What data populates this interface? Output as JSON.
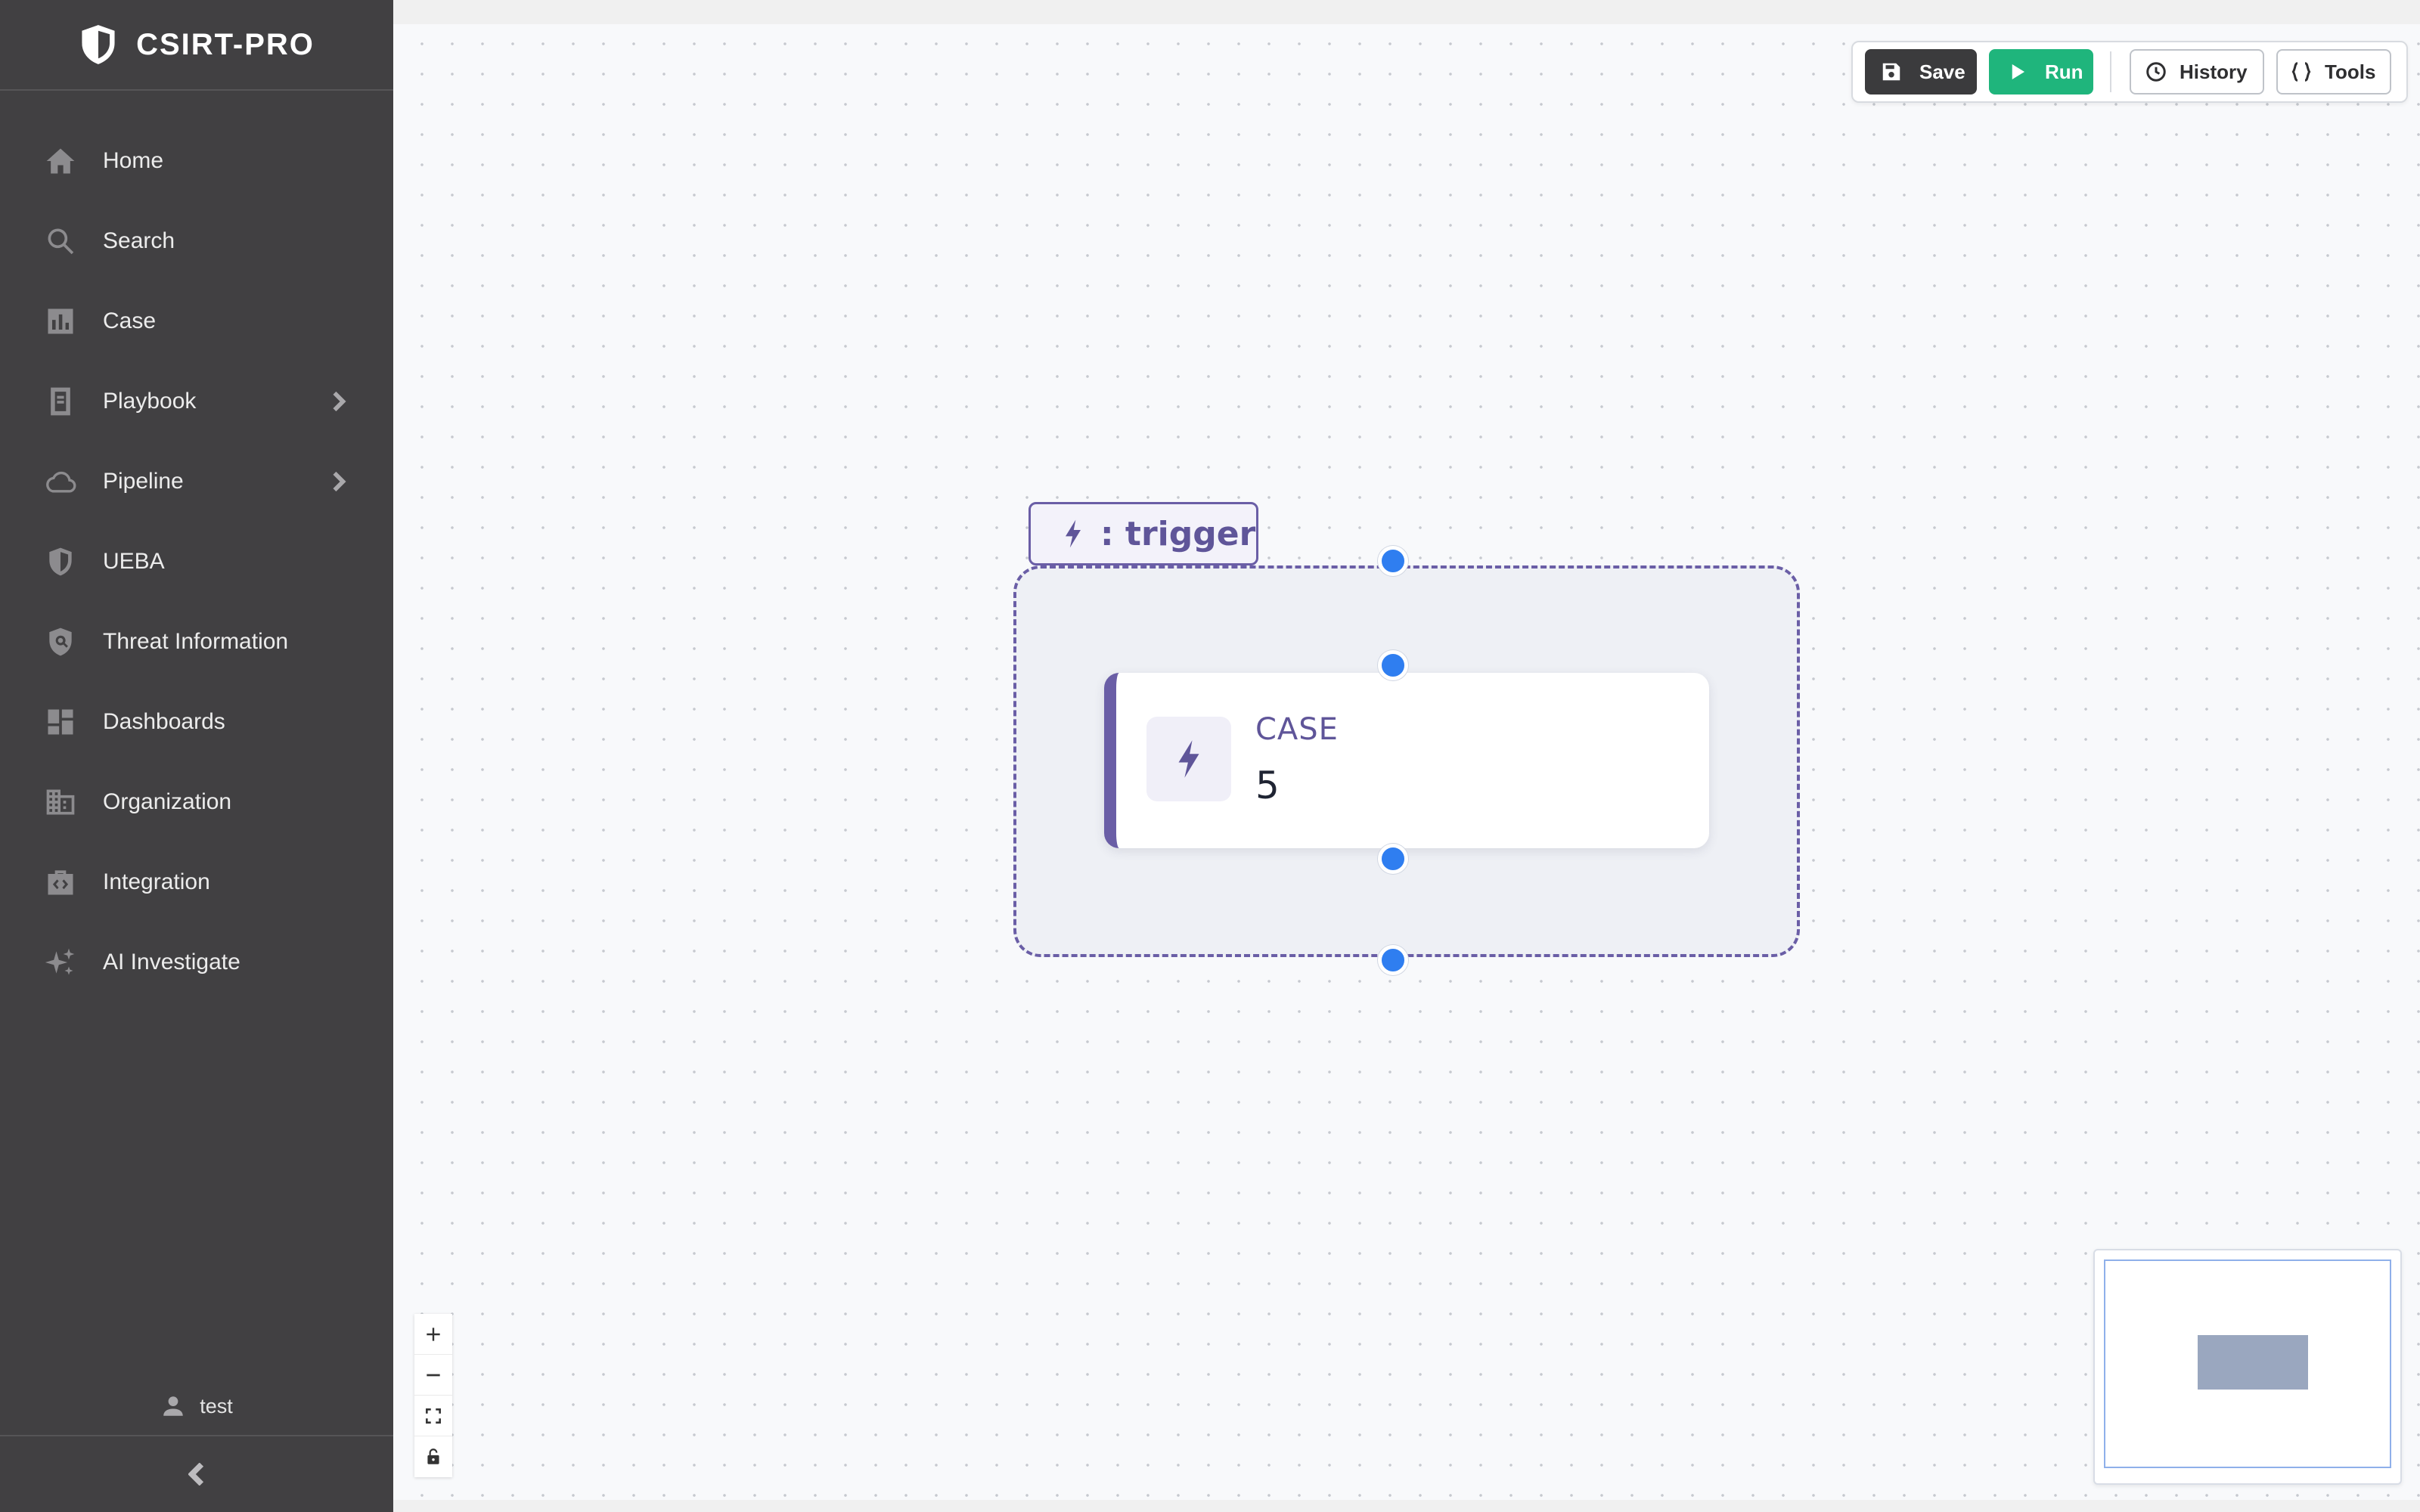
{
  "brand": {
    "name": "CSIRT-PRO",
    "icon": "shield-icon"
  },
  "sidebar": {
    "items": [
      {
        "label": "Home",
        "icon": "home-icon",
        "has_submenu": false
      },
      {
        "label": "Search",
        "icon": "search-icon",
        "has_submenu": false
      },
      {
        "label": "Case",
        "icon": "bar-chart-icon",
        "has_submenu": false
      },
      {
        "label": "Playbook",
        "icon": "book-icon",
        "has_submenu": true
      },
      {
        "label": "Pipeline",
        "icon": "cloud-icon",
        "has_submenu": true
      },
      {
        "label": "UEBA",
        "icon": "shield-icon",
        "has_submenu": false
      },
      {
        "label": "Threat Information",
        "icon": "shield-search-icon",
        "has_submenu": false
      },
      {
        "label": "Dashboards",
        "icon": "dashboard-icon",
        "has_submenu": false
      },
      {
        "label": "Organization",
        "icon": "building-icon",
        "has_submenu": false
      },
      {
        "label": "Integration",
        "icon": "integration-icon",
        "has_submenu": false
      },
      {
        "label": "AI Investigate",
        "icon": "sparkle-icon",
        "has_submenu": false
      }
    ],
    "user": "test"
  },
  "toolbar": {
    "save": "Save",
    "run": "Run",
    "history": "History",
    "tools": "Tools"
  },
  "flow": {
    "group_label": ": trigger",
    "node": {
      "type": "CASE",
      "value": "5"
    }
  },
  "colors": {
    "sidebar_bg": "#414042",
    "accent_purple": "#6a5ea6",
    "run_green": "#1fb57c",
    "handle_blue": "#2f7ef0"
  }
}
